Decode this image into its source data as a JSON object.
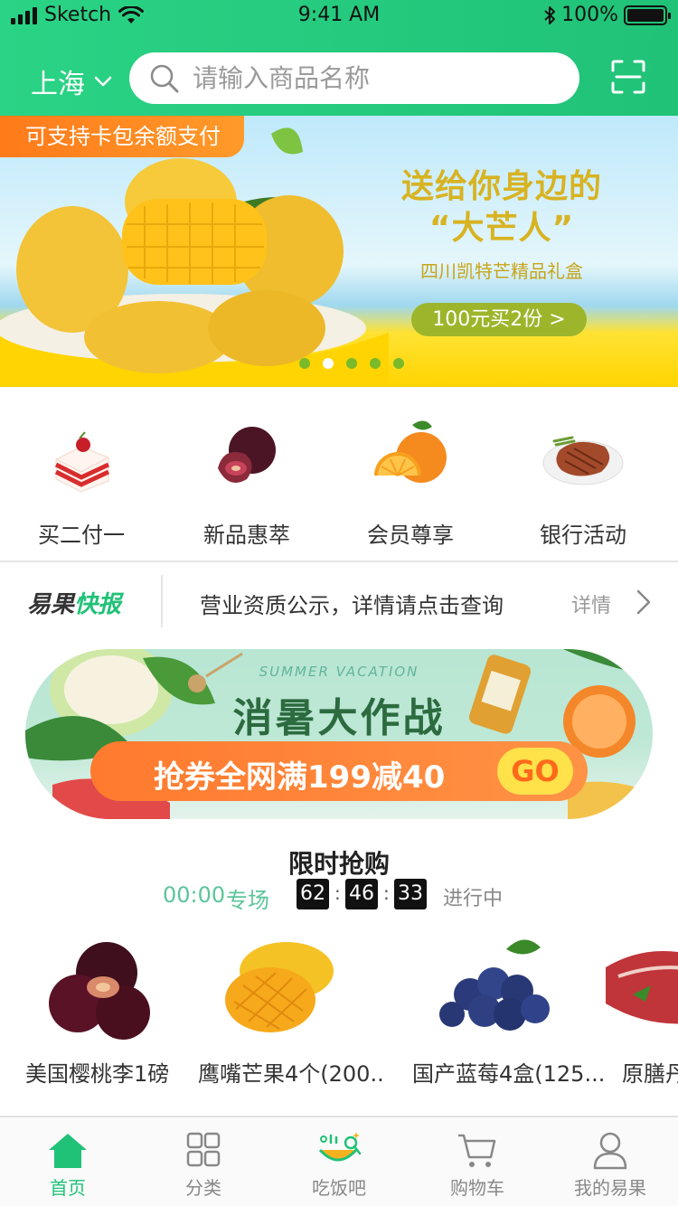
{
  "status_bar": {
    "carrier": "Sketch",
    "time": "9:41 AM",
    "battery": "100%",
    "battery_level": 1.0
  },
  "header": {
    "city": "上海",
    "search": {
      "placeholder": "请输入商品名称"
    },
    "icons": {
      "city_dropdown": "chevron-down-icon",
      "search": "search-icon",
      "scan": "scan-icon"
    }
  },
  "hero_banner": {
    "tag": "可支持卡包余额支付",
    "title_line1": "送给你身边的",
    "title_line2": "“大芒人”",
    "subtitle": "四川凯特芒精品礼盒",
    "cta": "100元买2份 >",
    "page_count": 5,
    "active_index": 1
  },
  "categories": [
    {
      "label": "买二付一",
      "icon": "cake-icon"
    },
    {
      "label": "新品惠萃",
      "icon": "plum-icon"
    },
    {
      "label": "会员尊享",
      "icon": "orange-icon"
    },
    {
      "label": "银行活动",
      "icon": "steak-icon"
    }
  ],
  "news": {
    "logo_part1": "易果",
    "logo_part2": "快报",
    "text": "营业资质公示，详情请点击查询",
    "more": "详情"
  },
  "promo": {
    "en": "SUMMER VACATION",
    "title": "消暑大作战",
    "text": "抢券全网满199减40",
    "go": "GO"
  },
  "flash_sale": {
    "title": "限时抢购",
    "session_time": "00:00",
    "session_label": "专场",
    "countdown": {
      "hours": "62",
      "minutes": "46",
      "seconds": "33"
    },
    "status": "进行中",
    "products": [
      {
        "name": "美国樱桃李1磅",
        "icon": "plum-icon"
      },
      {
        "name": "鹰嘴芒果4个(200...",
        "icon": "mango-icon"
      },
      {
        "name": "国产蓝莓4盒(125...",
        "icon": "blueberry-icon"
      },
      {
        "name": "原膳丹",
        "icon": "meat-icon"
      }
    ]
  },
  "tabbar": {
    "items": [
      {
        "label": "首页",
        "icon": "home-icon",
        "active": true
      },
      {
        "label": "分类",
        "icon": "grid-icon",
        "active": false
      },
      {
        "label": "吃饭吧",
        "icon": "dining-icon",
        "active": false
      },
      {
        "label": "购物车",
        "icon": "cart-icon",
        "active": false
      },
      {
        "label": "我的易果",
        "icon": "user-icon",
        "active": false
      }
    ]
  },
  "colors": {
    "brand_green": "#20c277",
    "orange": "#ff7a1a",
    "promo_green": "#2c6b3f",
    "gold": "#d8b321"
  }
}
